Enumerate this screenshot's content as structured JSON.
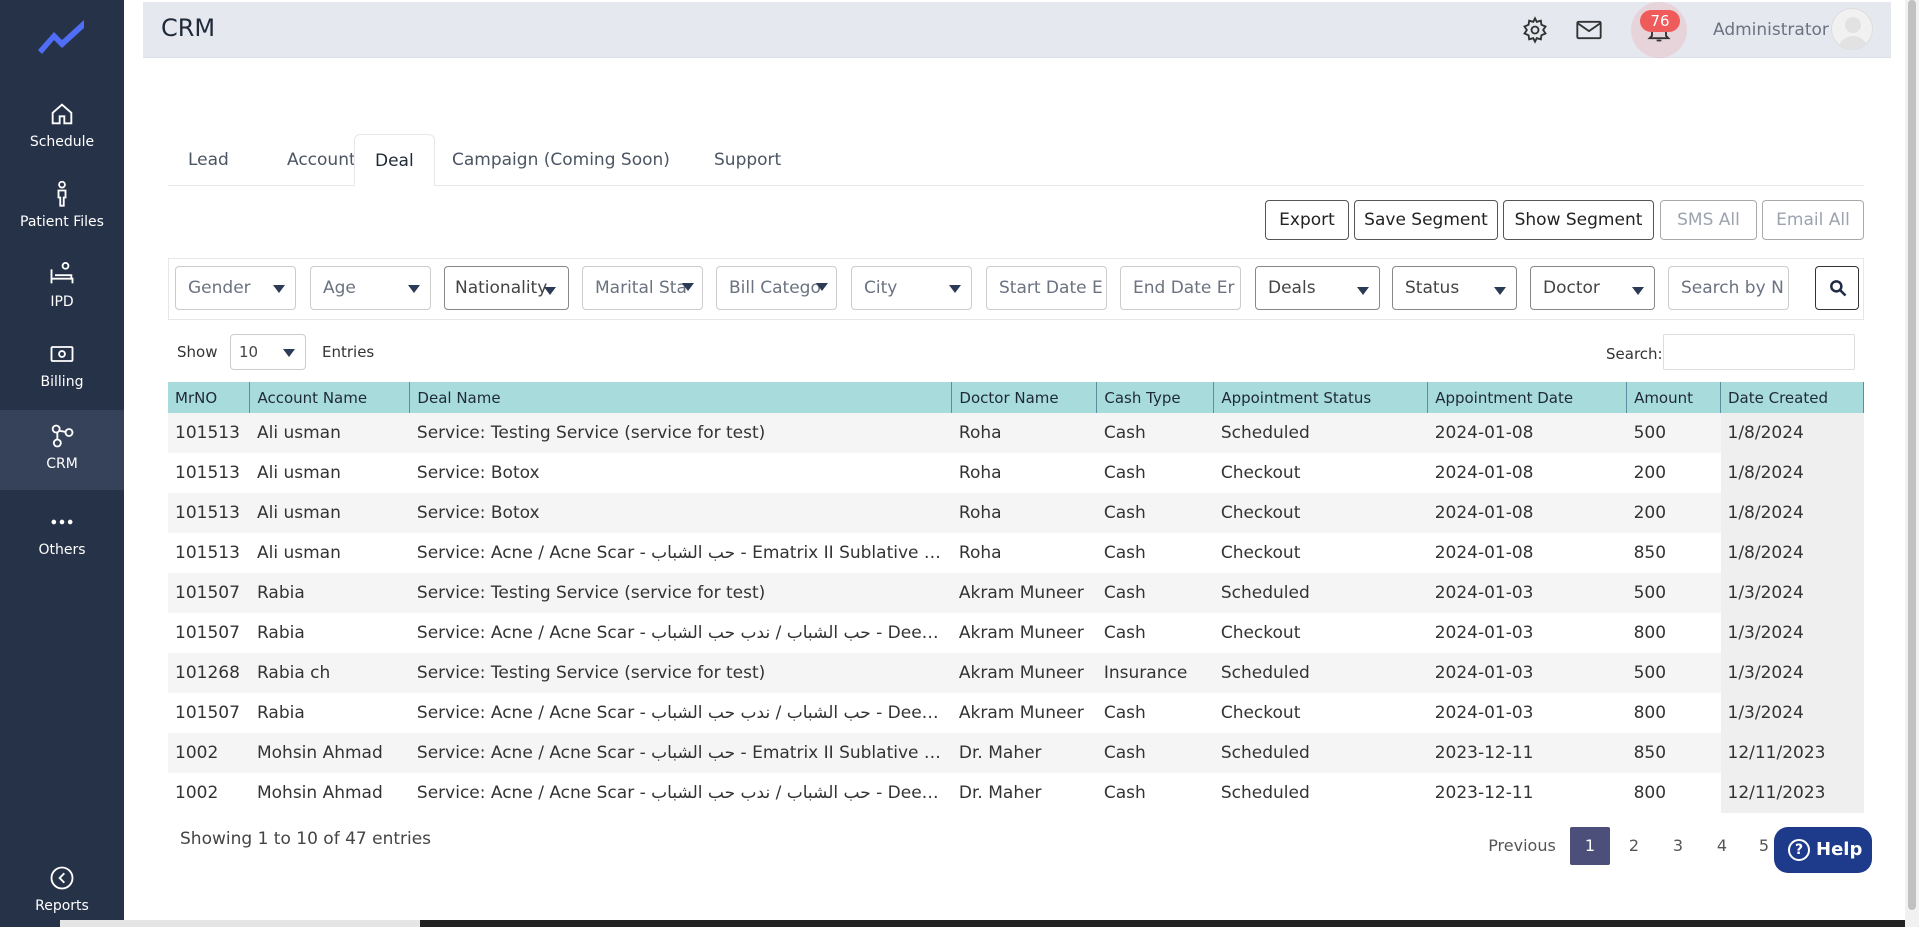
{
  "header": {
    "title": "CRM",
    "notifications_count": "76",
    "user_name": "Administrator"
  },
  "sidebar": {
    "items": [
      {
        "label": "Schedule",
        "icon": "home-icon"
      },
      {
        "label": "Patient Files",
        "icon": "person-icon"
      },
      {
        "label": "IPD",
        "icon": "bed-icon"
      },
      {
        "label": "Billing",
        "icon": "cash-icon"
      },
      {
        "label": "CRM",
        "icon": "network-icon"
      },
      {
        "label": "Others",
        "icon": "dots-icon"
      },
      {
        "label": "Reports",
        "icon": "chevron-circle-icon"
      }
    ],
    "active": "CRM"
  },
  "tabs": [
    {
      "label": "Lead"
    },
    {
      "label": "Account"
    },
    {
      "label": "Deal"
    },
    {
      "label": "Campaign (Coming Soon)"
    },
    {
      "label": "Support"
    }
  ],
  "active_tab": "Deal",
  "actions": {
    "export": "Export",
    "save_segment": "Save Segment",
    "show_segment": "Show Segment",
    "sms_all": "SMS All",
    "email_all": "Email All"
  },
  "filters": {
    "gender": "Gender",
    "age": "Age",
    "nationality": "Nationality",
    "marital_status": "Marital Sta",
    "bill_category": "Bill Catego",
    "city": "City",
    "start_date": "Start Date E",
    "end_date": "End Date Er",
    "deals": "Deals",
    "status": "Status",
    "doctor": "Doctor",
    "search_placeholder": "Search by N"
  },
  "entries": {
    "show_label": "Show",
    "value": "10",
    "entries_label": "Entries",
    "search_label": "Search:"
  },
  "table": {
    "columns": [
      "MrNO",
      "Account Name",
      "Deal Name",
      "Doctor Name",
      "Cash Type",
      "Appointment Status",
      "Appointment Date",
      "Amount",
      "Date Created"
    ],
    "rows": [
      [
        "101513",
        "Ali usman",
        "Service: Testing Service (service for test)",
        "Roha",
        "Cash",
        "Scheduled",
        "2024-01-08",
        "500",
        "1/8/2024"
      ],
      [
        "101513",
        "Ali usman",
        "Service: Botox",
        "Roha",
        "Cash",
        "Checkout",
        "2024-01-08",
        "200",
        "1/8/2024"
      ],
      [
        "101513",
        "Ali usman",
        "Service: Botox",
        "Roha",
        "Cash",
        "Checkout",
        "2024-01-08",
        "200",
        "1/8/2024"
      ],
      [
        "101513",
        "Ali usman",
        "Service: Acne / Acne Scar - حب الشباب - Ematrix II Sublative RF طحي...",
        "Roha",
        "Cash",
        "Checkout",
        "2024-01-08",
        "850",
        "1/8/2024"
      ],
      [
        "101507",
        "Rabia",
        "Service: Testing Service (service for test)",
        "Akram Muneer",
        "Cash",
        "Scheduled",
        "2024-01-03",
        "500",
        "1/3/2024"
      ],
      [
        "101507",
        "Rabia",
        "Service: Acne / Acne Scar - حب الشباب / ندب حب الشباب - Deep Fraction...",
        "Akram Muneer",
        "Cash",
        "Checkout",
        "2024-01-03",
        "800",
        "1/3/2024"
      ],
      [
        "101268",
        "Rabia ch",
        "Service: Testing Service (service for test)",
        "Akram Muneer",
        "Insurance",
        "Scheduled",
        "2024-01-03",
        "500",
        "1/3/2024"
      ],
      [
        "101507",
        "Rabia",
        "Service: Acne / Acne Scar - حب الشباب / ندب حب الشباب - Deep Fraction...",
        "Akram Muneer",
        "Cash",
        "Checkout",
        "2024-01-03",
        "800",
        "1/3/2024"
      ],
      [
        "1002",
        "Mohsin Ahmad",
        "Service: Acne / Acne Scar - حب الشباب - Ematrix II Sublative RF طحي...",
        "Dr. Maher",
        "Cash",
        "Scheduled",
        "2023-12-11",
        "850",
        "12/11/2023"
      ],
      [
        "1002",
        "Mohsin Ahmad",
        "Service: Acne / Acne Scar - حب الشباب / ندب حب الشباب - Deep Fraction...",
        "Dr. Maher",
        "Cash",
        "Scheduled",
        "2023-12-11",
        "800",
        "12/11/2023"
      ]
    ]
  },
  "footer": {
    "showing": "Showing 1 to 10 of 47 entries",
    "previous": "Previous",
    "pages": [
      "1",
      "2",
      "3",
      "4",
      "5"
    ],
    "current_page": "1",
    "help": "Help"
  },
  "colors": {
    "sidebar_bg": "#263247",
    "table_header_bg": "#a7dbdc",
    "active_page_bg": "#4b4f7a",
    "help_bg": "#1e3a8a",
    "badge_bg": "#ef5b5b"
  }
}
